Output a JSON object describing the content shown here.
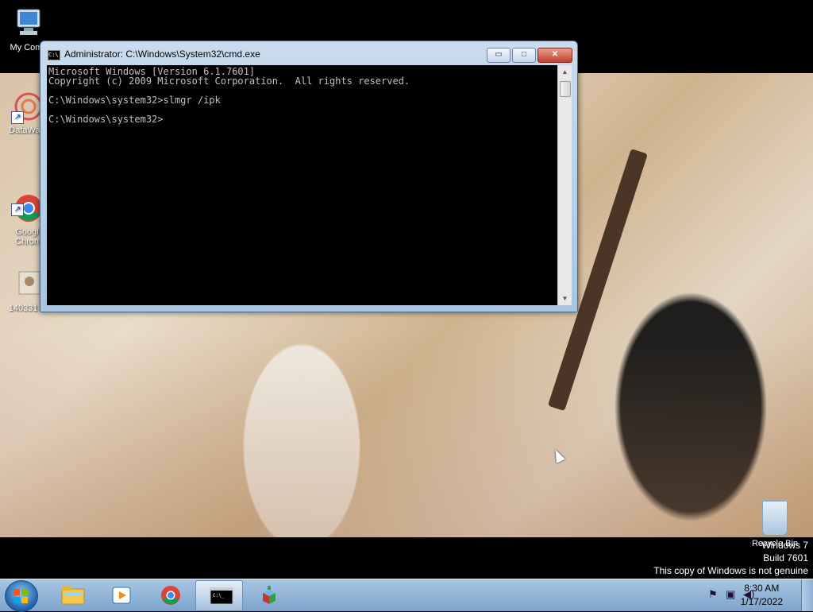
{
  "desktop": {
    "icons": [
      {
        "label": "My Comp",
        "icon": "computer-icon"
      },
      {
        "label": "DataWag",
        "icon": "datawag-icon"
      },
      {
        "label": "Googl\nChron",
        "icon": "chrome-icon"
      },
      {
        "label": "140331-d",
        "icon": "image-file-icon"
      }
    ],
    "recycle_bin": {
      "label": "Recycle Bin",
      "icon": "recycle-bin-icon"
    },
    "watermark": {
      "line1": "Windows 7",
      "line2": "Build 7601",
      "line3": "This copy of Windows is not genuine"
    }
  },
  "cmd_window": {
    "title": "Administrator: C:\\Windows\\System32\\cmd.exe",
    "minimize_label": "▭",
    "maximize_label": "□",
    "close_label": "✕",
    "console_text": "Microsoft Windows [Version 6.1.7601]\nCopyright (c) 2009 Microsoft Corporation.  All rights reserved.\n\nC:\\Windows\\system32>slmgr /ipk\n\nC:\\Windows\\system32>"
  },
  "taskbar": {
    "start_icon": "windows-start-icon",
    "items": [
      {
        "name": "file-explorer",
        "icon": "folder-icon",
        "active": false
      },
      {
        "name": "media-player",
        "icon": "media-player-icon",
        "active": false
      },
      {
        "name": "google-chrome",
        "icon": "chrome-icon",
        "active": false
      },
      {
        "name": "command-prompt",
        "icon": "cmd-icon",
        "active": true
      },
      {
        "name": "app-3d",
        "icon": "cube-app-icon",
        "active": false
      }
    ],
    "tray": {
      "time": "8:30 AM",
      "date": "1/17/2022"
    }
  }
}
